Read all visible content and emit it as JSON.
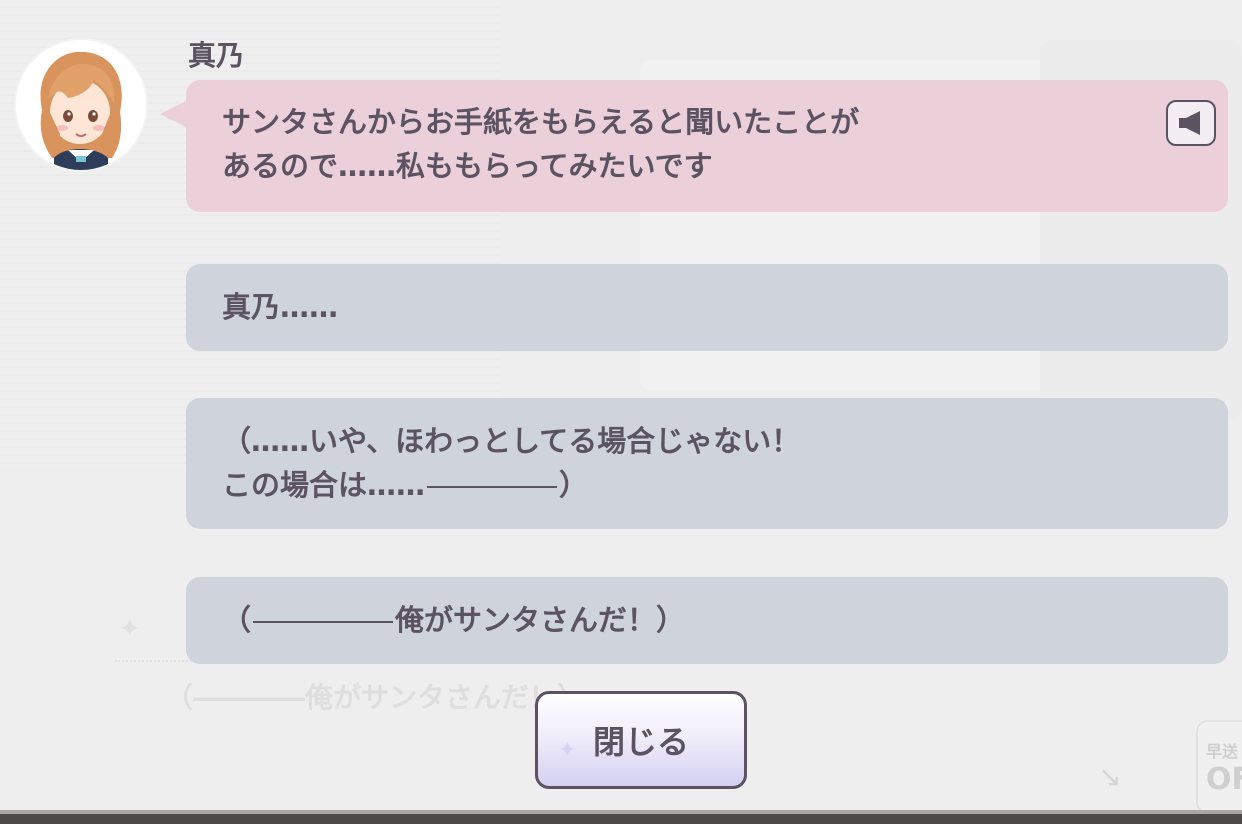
{
  "speaker": {
    "name": "真乃",
    "avatar_icon": "character-avatar-icon"
  },
  "messages": [
    {
      "type": "speech",
      "lines": [
        "サンタさんからお手紙をもらえると聞いたことが",
        "あるので……私ももらってみたいです"
      ],
      "voice_icon": "speaker-icon"
    },
    {
      "type": "response",
      "lines": [
        "真乃……"
      ]
    },
    {
      "type": "monologue",
      "line1": "（……いや、ほわっとしてる場合じゃない！",
      "line2_text": "この場合は……",
      "line2_end": "）"
    },
    {
      "type": "monologue",
      "open": "（",
      "text": "俺がサンタさんだ！）"
    }
  ],
  "close_button": {
    "label": "閉じる"
  },
  "background": {
    "ghost_text": "（――――俺がサンタさんだ！）",
    "skip_label": "早送",
    "skip_value": "OF"
  },
  "colors": {
    "speech_bubble": "#ebd0da",
    "response_bubble": "#cfd4dc",
    "text": "#5b5362",
    "button_accent": "#d4d0f2"
  }
}
